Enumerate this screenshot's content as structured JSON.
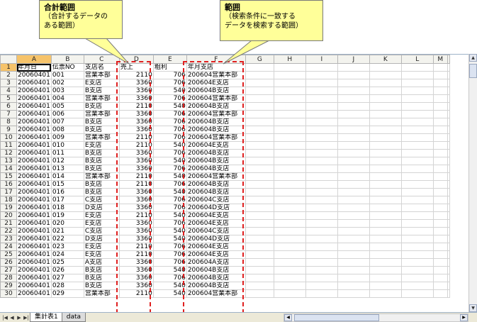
{
  "columns": [
    "A",
    "B",
    "C",
    "D",
    "E",
    "F",
    "G",
    "H",
    "I",
    "J",
    "K",
    "L",
    "M"
  ],
  "active_column": "A",
  "active_row": "1",
  "header_row": [
    "年月日",
    "伝票NO",
    "支店名",
    "売上",
    "粗利",
    "年月支店"
  ],
  "rows": [
    [
      "20060401",
      "001",
      "営業本部",
      "2110",
      "706",
      "200604営業本部"
    ],
    [
      "20060401",
      "002",
      "E支店",
      "3360",
      "706",
      "200604E支店"
    ],
    [
      "20060401",
      "003",
      "B支店",
      "3360",
      "540",
      "200604B支店"
    ],
    [
      "20060401",
      "004",
      "営業本部",
      "3360",
      "706",
      "200604営業本部"
    ],
    [
      "20060401",
      "005",
      "B支店",
      "2110",
      "540",
      "200604B支店"
    ],
    [
      "20060401",
      "006",
      "営業本部",
      "3360",
      "706",
      "200604営業本部"
    ],
    [
      "20060401",
      "007",
      "B支店",
      "3360",
      "706",
      "200604B支店"
    ],
    [
      "20060401",
      "008",
      "B支店",
      "3360",
      "706",
      "200604B支店"
    ],
    [
      "20060401",
      "009",
      "営業本部",
      "2110",
      "706",
      "200604営業本部"
    ],
    [
      "20060401",
      "010",
      "E支店",
      "2110",
      "540",
      "200604E支店"
    ],
    [
      "20060401",
      "011",
      "B支店",
      "3360",
      "706",
      "200604B支店"
    ],
    [
      "20060401",
      "012",
      "B支店",
      "3360",
      "540",
      "200604B支店"
    ],
    [
      "20060401",
      "013",
      "B支店",
      "3360",
      "706",
      "200604B支店"
    ],
    [
      "20060401",
      "014",
      "営業本部",
      "2110",
      "540",
      "200604営業本部"
    ],
    [
      "20060401",
      "015",
      "B支店",
      "2110",
      "706",
      "200604B支店"
    ],
    [
      "20060401",
      "016",
      "B支店",
      "3360",
      "540",
      "200604B支店"
    ],
    [
      "20060401",
      "017",
      "C支店",
      "3360",
      "706",
      "200604C支店"
    ],
    [
      "20060401",
      "018",
      "D支店",
      "3360",
      "706",
      "200604D支店"
    ],
    [
      "20060401",
      "019",
      "E支店",
      "2110",
      "540",
      "200604E支店"
    ],
    [
      "20060401",
      "020",
      "E支店",
      "3360",
      "706",
      "200604E支店"
    ],
    [
      "20060401",
      "021",
      "C支店",
      "3360",
      "540",
      "200604C支店"
    ],
    [
      "20060401",
      "022",
      "D支店",
      "3360",
      "540",
      "200604D支店"
    ],
    [
      "20060401",
      "023",
      "E支店",
      "2110",
      "706",
      "200604E支店"
    ],
    [
      "20060401",
      "024",
      "E支店",
      "2110",
      "706",
      "200604E支店"
    ],
    [
      "20060401",
      "025",
      "A支店",
      "3360",
      "706",
      "200604A支店"
    ],
    [
      "20060401",
      "026",
      "B支店",
      "3360",
      "540",
      "200604B支店"
    ],
    [
      "20060401",
      "027",
      "B支店",
      "3360",
      "706",
      "200604B支店"
    ],
    [
      "20060401",
      "028",
      "B支店",
      "3360",
      "540",
      "200604B支店"
    ],
    [
      "20060401",
      "029",
      "営業本部",
      "2110",
      "540",
      "200604営業本部"
    ]
  ],
  "sheet_tabs": [
    {
      "label": "集計表1",
      "active": true
    },
    {
      "label": "data",
      "active": false
    }
  ],
  "callouts": {
    "sum_range": {
      "title": "合計範囲",
      "line1": "（合計するデータの",
      "line2": "ある範囲）"
    },
    "criteria_range": {
      "title": "範囲",
      "line1": "（検索条件に一致する",
      "line2": "データを検索する範囲）"
    }
  },
  "colors": {
    "callout_bg": "#ffff99",
    "range_border": "#e02020",
    "header_bg": "#f3f3ee",
    "selected_header_bg": "#f6c36a"
  },
  "icons": {
    "tab_first": "first-sheet-icon",
    "tab_prev": "prev-sheet-icon",
    "tab_next": "next-sheet-icon",
    "tab_last": "last-sheet-icon"
  }
}
